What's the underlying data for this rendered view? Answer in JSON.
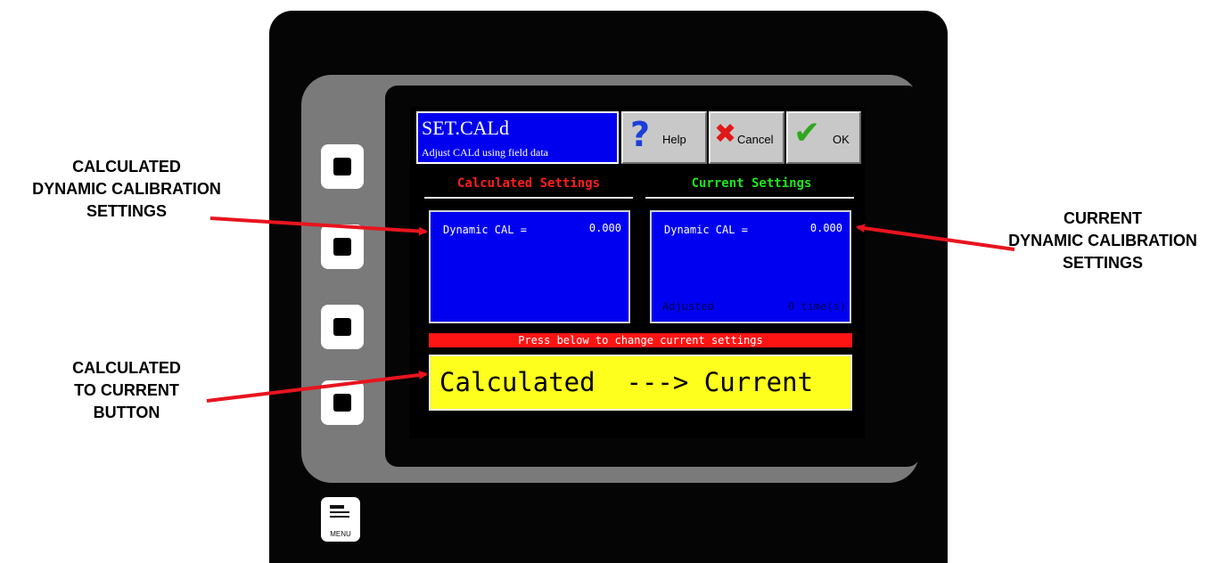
{
  "screen": {
    "title": "SET.CALd",
    "subtitle": "Adjust CALd using field data",
    "buttons": {
      "help": "Help",
      "cancel": "Cancel",
      "ok": "OK"
    },
    "calculated": {
      "header": "Calculated Settings",
      "label": "Dynamic CAL =",
      "value": "0.000"
    },
    "current": {
      "header": "Current Settings",
      "label": "Dynamic CAL =",
      "value": "0.000",
      "adjusted_label": "Adjusted",
      "adjusted_count": "0 time(s)"
    },
    "notice": "Press below to change current settings",
    "transfer_button": "Calculated  ---> Current"
  },
  "device": {
    "menu_label": "MENU"
  },
  "annotations": {
    "left_top": [
      "CALCULATED",
      "DYNAMIC CALIBRATION",
      "SETTINGS"
    ],
    "left_bottom": [
      "CALCULATED",
      "TO CURRENT",
      "BUTTON"
    ],
    "right": [
      "CURRENT",
      "DYNAMIC CALIBRATION",
      "SETTINGS"
    ]
  },
  "colors": {
    "title_bg": "#0000ee",
    "panel_bg": "#0000f0",
    "calculated_header": "#ff1e1e",
    "current_header": "#1ee61e",
    "notice_bg": "#ff1414",
    "button_bg": "#ffff1e",
    "arrow": "#e8141e"
  },
  "icons": [
    "help-question-icon",
    "cancel-x-icon",
    "ok-check-icon",
    "menu-icon"
  ]
}
